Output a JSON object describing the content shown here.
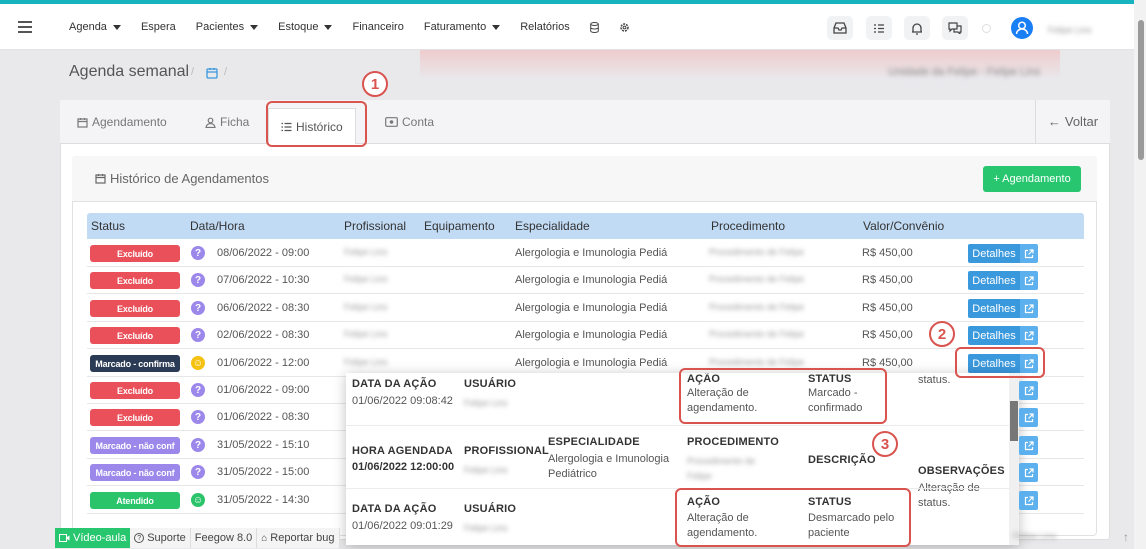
{
  "nav": {
    "menu": [
      "Agenda",
      "Espera",
      "Pacientes",
      "Estoque",
      "Financeiro",
      "Faturamento",
      "Relatórios"
    ],
    "menu_has_caret": [
      true,
      false,
      true,
      true,
      false,
      true,
      false
    ],
    "user_name": "Felipe Lins"
  },
  "page": {
    "title": "Agenda semanal",
    "sep": "/",
    "unit_name": "Unidade da Felipe - Felipe Lins"
  },
  "tabs": {
    "agendamento": "Agendamento",
    "ficha": "Ficha",
    "historico": "Histórico",
    "conta": "Conta",
    "voltar": "Voltar"
  },
  "history": {
    "title": "Histórico de Agendamentos",
    "add_button": "+ Agendamento",
    "columns": {
      "status": "Status",
      "date": "Data/Hora",
      "professional": "Profissional",
      "equipment": "Equipamento",
      "specialty": "Especialidade",
      "procedure": "Procedimento",
      "value": "Valor/Convênio"
    },
    "details_label": "Detalhes",
    "rows": [
      {
        "status": "Excluído",
        "color": "#e9505a",
        "icon": "question",
        "date": "08/06/2022 - 09:00",
        "prof": "Felipe Lins",
        "esp": "Alergologia e Imunologia Pediá",
        "proc": "Procedimento de Felipe",
        "val": "R$ 450,00"
      },
      {
        "status": "Excluído",
        "color": "#e9505a",
        "icon": "question",
        "date": "07/06/2022 - 10:30",
        "prof": "Felipe Lins",
        "esp": "Alergologia e Imunologia Pediá",
        "proc": "Procedimento de Felipe",
        "val": "R$ 450,00"
      },
      {
        "status": "Excluído",
        "color": "#e9505a",
        "icon": "question",
        "date": "06/06/2022 - 08:30",
        "prof": "Felipe Lins",
        "esp": "Alergologia e Imunologia Pediá",
        "proc": "Procedimento de Felipe",
        "val": "R$ 450,00"
      },
      {
        "status": "Excluído",
        "color": "#e9505a",
        "icon": "question",
        "date": "02/06/2022 - 08:30",
        "prof": "Felipe Lins",
        "esp": "Alergologia e Imunologia Pediá",
        "proc": "Procedimento de Felipe",
        "val": "R$ 450,00"
      },
      {
        "status": "Marcado - confirma",
        "color": "#2c3b55",
        "icon": "smile-yellow",
        "date": "01/06/2022 - 12:00",
        "prof": "Felipe Lins",
        "esp": "Alergologia e Imunologia Pediá",
        "proc": "Procedimento de Felipe",
        "val": "R$ 450,00"
      },
      {
        "status": "Excluído",
        "color": "#e9505a",
        "icon": "question",
        "date": "01/06/2022 - 09:00"
      },
      {
        "status": "Excluído",
        "color": "#e9505a",
        "icon": "question",
        "date": "01/06/2022 - 08:30"
      },
      {
        "status": "Marcado - não conf",
        "color": "#9b88ea",
        "icon": "question",
        "date": "31/05/2022 - 15:10"
      },
      {
        "status": "Marcado - não conf",
        "color": "#9b88ea",
        "icon": "question",
        "date": "31/05/2022 - 15:00"
      },
      {
        "status": "Atendido",
        "color": "#2bc46b",
        "icon": "smile-green",
        "date": "31/05/2022 - 14:30"
      }
    ],
    "right_fragments": [
      "status.",
      "status."
    ]
  },
  "popup": {
    "entry1": {
      "date_label": "DATA DA AÇÃO",
      "date": "01/06/2022 09:08:42",
      "user_label": "USUÁRIO",
      "user": "Felipe Lins",
      "action_label": "AÇÃO",
      "action": "Alteração de agendamento.",
      "status_label": "STATUS",
      "status": "Marcado - confirmado"
    },
    "details": {
      "hora_label": "HORA AGENDADA",
      "hora": "01/06/2022 12:00:00",
      "prof_label": "PROFISSIONAL",
      "prof": "Felipe Lins",
      "esp_label": "ESPECIALIDADE",
      "esp": "Alergologia e Imunologia Pediátrico",
      "proc_label": "PROCEDIMENTO",
      "proc": "Procedimento de Felipe",
      "desc_label": "DESCRIÇÃO",
      "obs_label": "OBSERVAÇÕES",
      "obs": "Alteração de status."
    },
    "entry2": {
      "date_label": "DATA DA AÇÃO",
      "date": "01/06/2022 09:01:29",
      "user_label": "USUÁRIO",
      "user": "Felipe Lins",
      "action_label": "AÇÃO",
      "action": "Alteração de agendamento.",
      "status_label": "STATUS",
      "status": "Desmarcado pelo paciente"
    }
  },
  "annotations": [
    "1",
    "2",
    "3"
  ],
  "footer": {
    "video": "Vídeo-aula",
    "support": "Suporte",
    "version": "Feegow 8.0",
    "bug": "Reportar bug",
    "right_blur": "Felipe Lins"
  }
}
